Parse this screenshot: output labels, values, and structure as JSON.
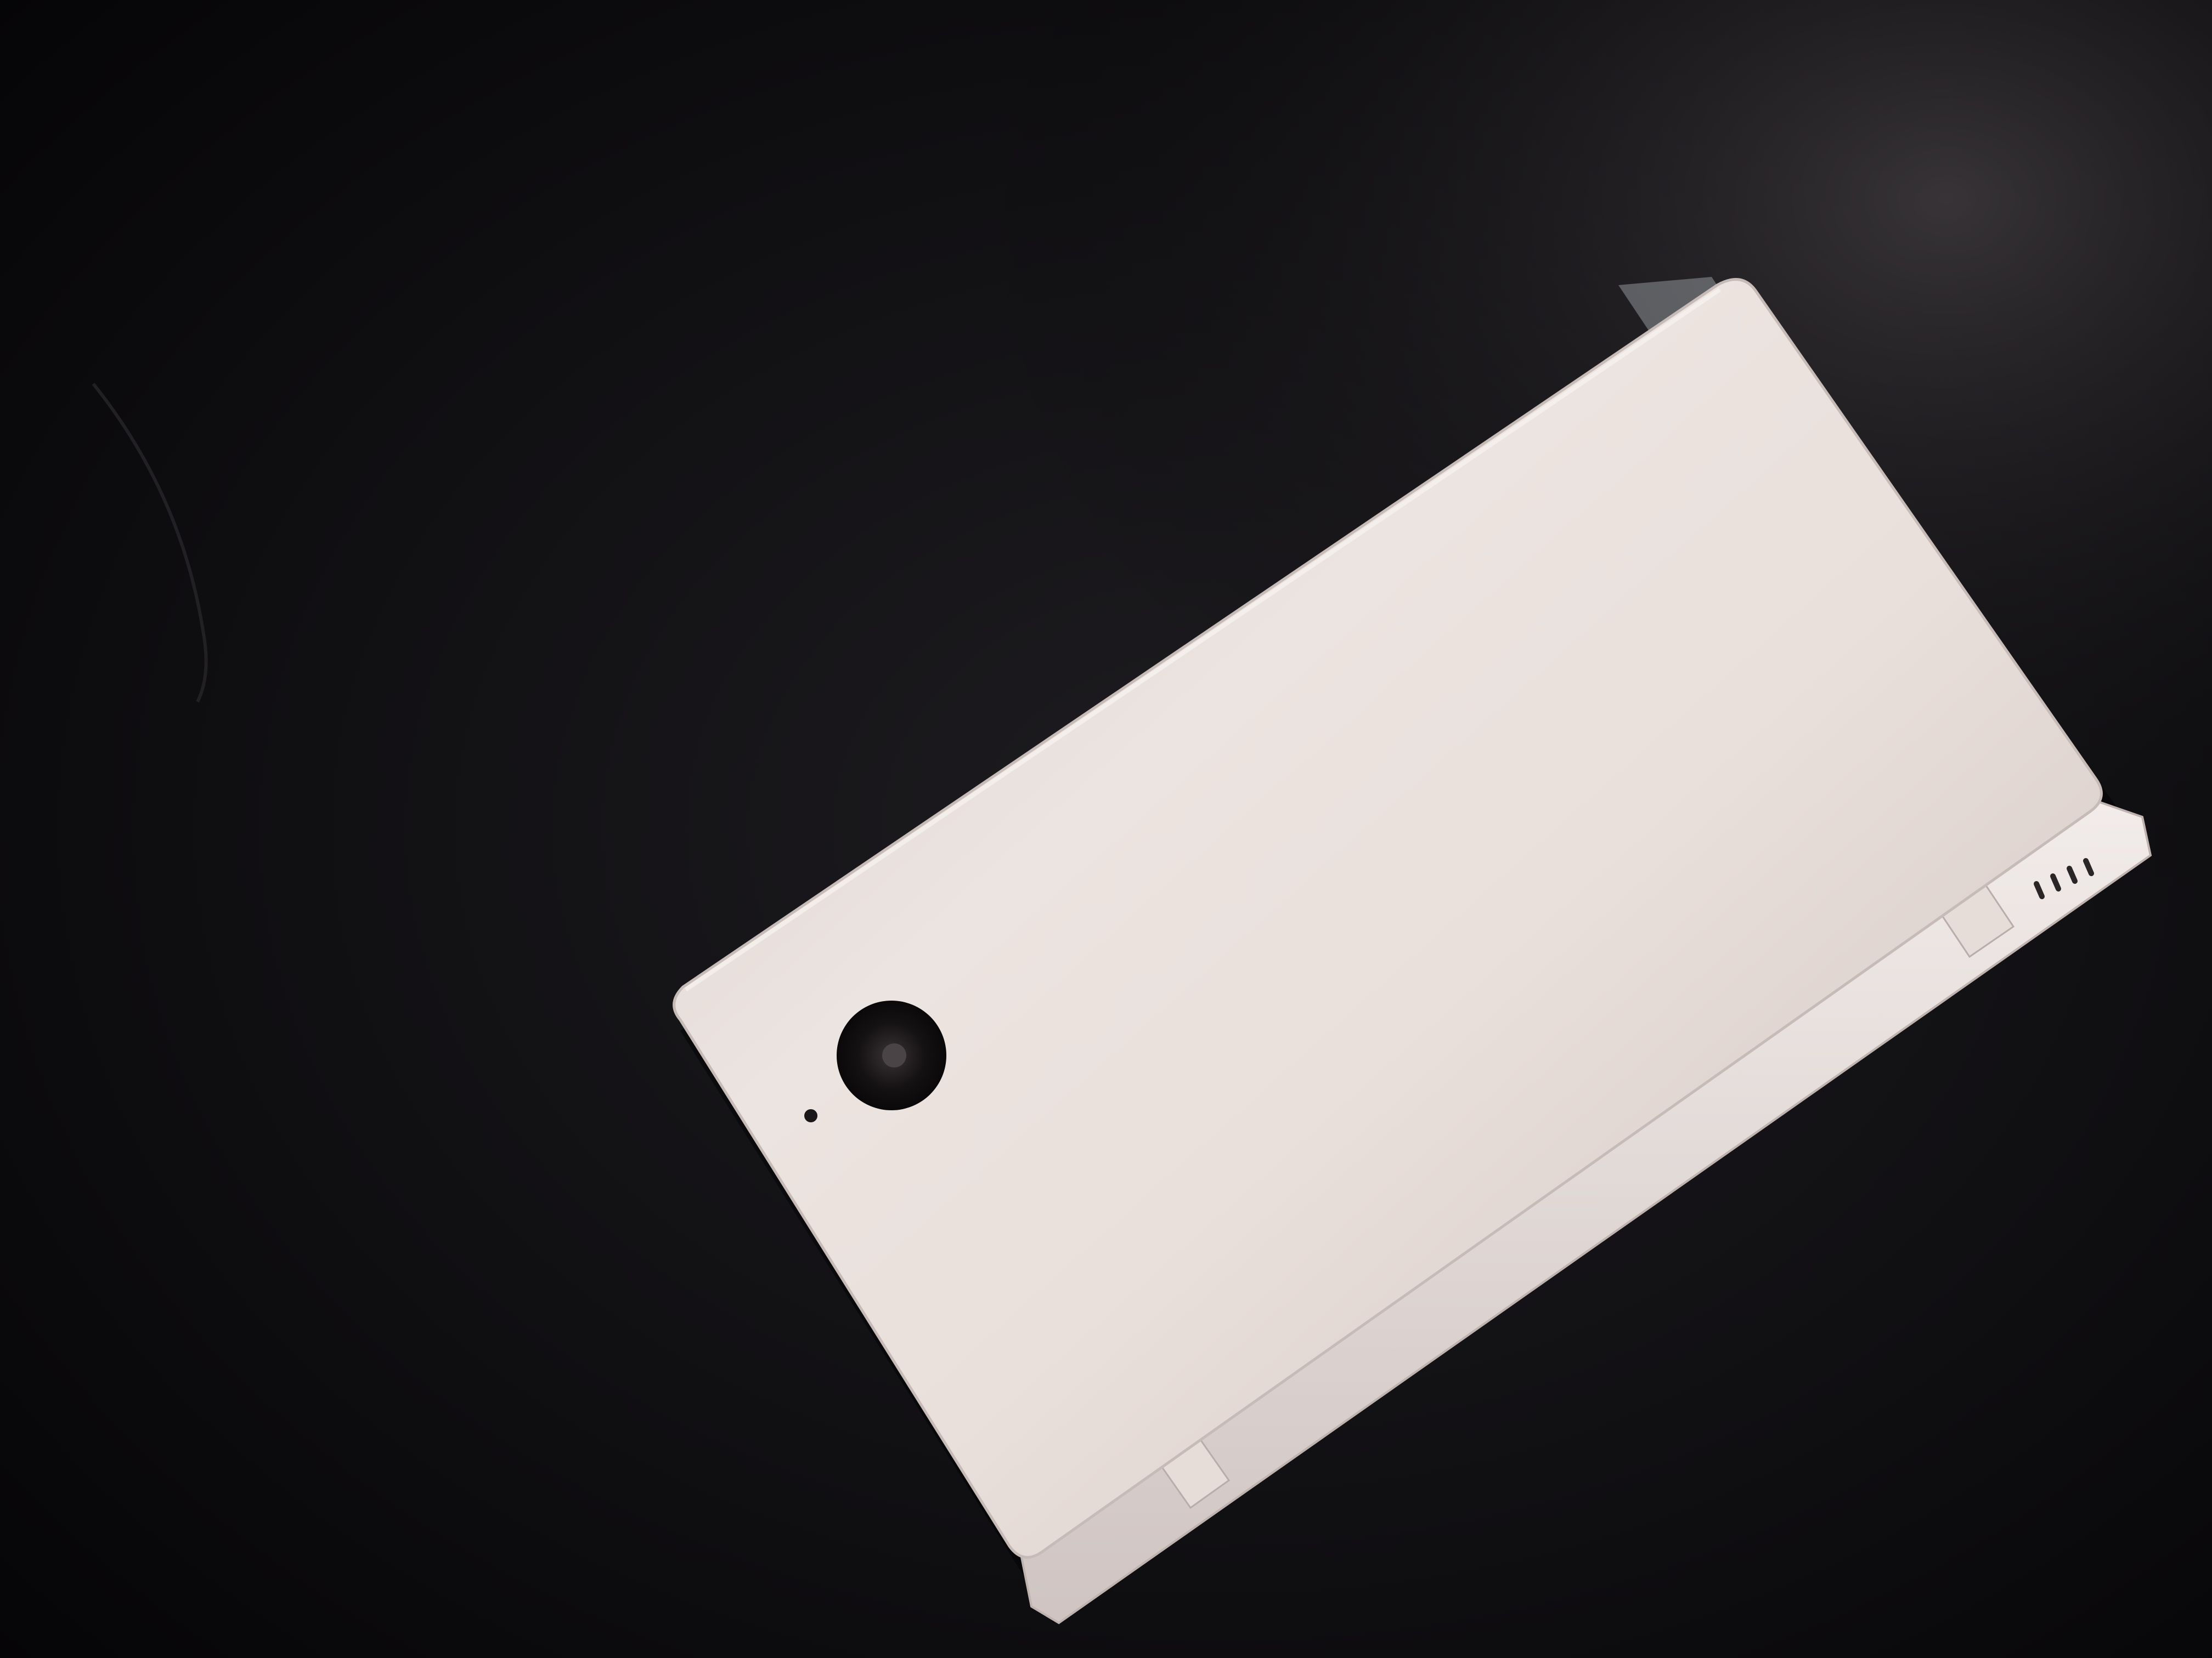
{
  "photo": {
    "surface_color": "#0b0a0d",
    "device_body_color": "#e8ddd8",
    "device_shadow_color": "#b8aba8",
    "camera_ring_color": "#1a1718",
    "speaker_slot_color": "#2a2628",
    "tape_color": "#cfd6dc"
  }
}
